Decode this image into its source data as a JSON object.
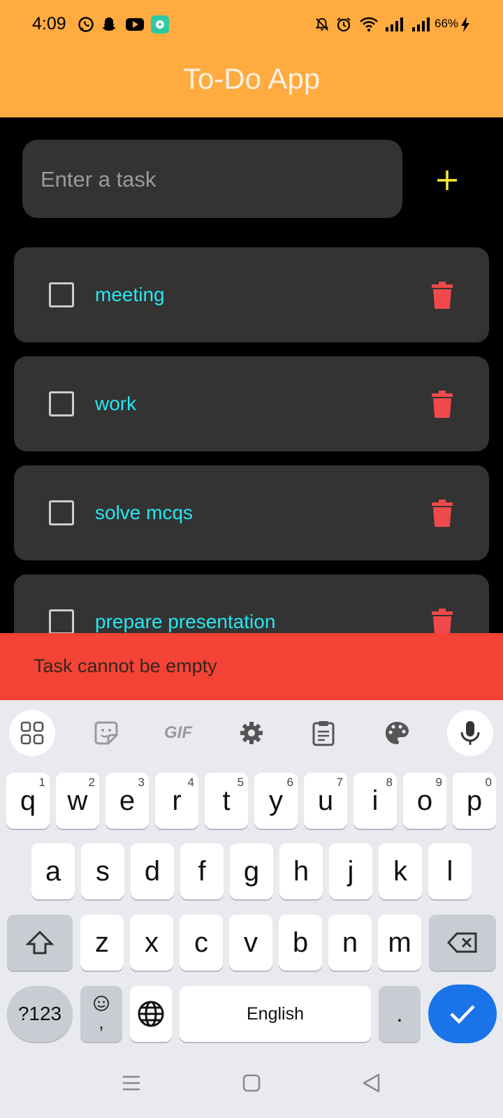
{
  "status": {
    "time": "4:09",
    "battery": "66%",
    "icons": [
      "whatsapp-icon",
      "snapchat-icon",
      "youtube-icon",
      "app-icon",
      "mute-icon",
      "alarm-icon",
      "wifi-icon",
      "signal-icon",
      "signal-icon",
      "charging-icon"
    ]
  },
  "app": {
    "title": "To-Do App"
  },
  "input": {
    "placeholder": "Enter a task",
    "value": ""
  },
  "add_button": {
    "label": "+",
    "color": "#FFEB3B"
  },
  "tasks": [
    {
      "label": "meeting",
      "checked": false
    },
    {
      "label": "work",
      "checked": false
    },
    {
      "label": "solve mcqs",
      "checked": false
    },
    {
      "label": "prepare presentation",
      "checked": false
    }
  ],
  "snackbar": {
    "message": "Task cannot be empty",
    "color": "#F44336"
  },
  "keyboard": {
    "toolbar": [
      "apps-icon",
      "sticker-icon",
      "gif-icon",
      "settings-icon",
      "clipboard-icon",
      "palette-icon",
      "mic-icon"
    ],
    "gif_label": "GIF",
    "row1": [
      {
        "k": "q",
        "n": "1"
      },
      {
        "k": "w",
        "n": "2"
      },
      {
        "k": "e",
        "n": "3"
      },
      {
        "k": "r",
        "n": "4"
      },
      {
        "k": "t",
        "n": "5"
      },
      {
        "k": "y",
        "n": "6"
      },
      {
        "k": "u",
        "n": "7"
      },
      {
        "k": "i",
        "n": "8"
      },
      {
        "k": "o",
        "n": "9"
      },
      {
        "k": "p",
        "n": "0"
      }
    ],
    "row2": [
      "a",
      "s",
      "d",
      "f",
      "g",
      "h",
      "j",
      "k",
      "l"
    ],
    "row3": [
      "z",
      "x",
      "c",
      "v",
      "b",
      "n",
      "m"
    ],
    "symbols_label": "?123",
    "comma": ",",
    "space_label": "English",
    "period": "."
  },
  "colors": {
    "appbar": "#FFAB40",
    "card": "#333333",
    "task_text": "#28E6F0",
    "delete": "#F0494B",
    "enter_key": "#1A73E8"
  }
}
